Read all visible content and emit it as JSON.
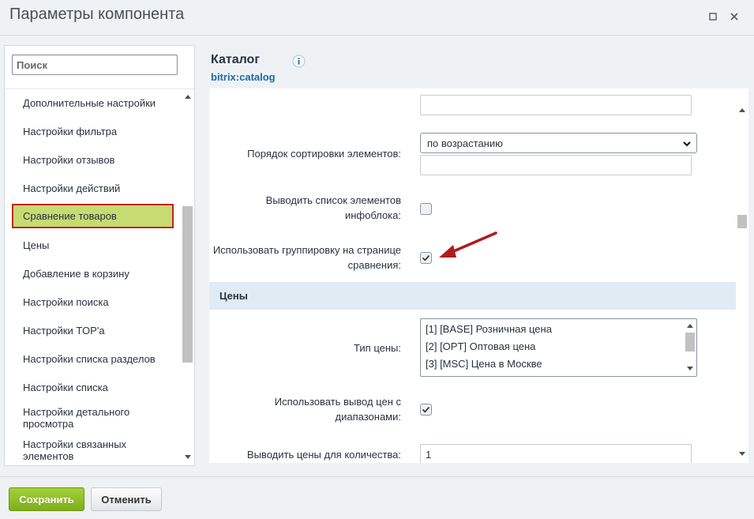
{
  "window": {
    "title": "Параметры компонента"
  },
  "sidebar": {
    "search_placeholder": "Поиск",
    "items": [
      {
        "label": "Дополнительные настройки"
      },
      {
        "label": "Настройки фильтра"
      },
      {
        "label": "Настройки отзывов"
      },
      {
        "label": "Настройки действий"
      },
      {
        "label": "Сравнение товаров",
        "active": true
      },
      {
        "label": "Цены"
      },
      {
        "label": "Добавление в корзину"
      },
      {
        "label": "Настройки поиска"
      },
      {
        "label": "Настройки TOP'а"
      },
      {
        "label": "Настройки списка разделов"
      },
      {
        "label": "Настройки списка"
      },
      {
        "label": "Настройки детального просмотра"
      },
      {
        "label": "Настройки связанных элементов"
      }
    ]
  },
  "component": {
    "name": "Каталог",
    "code": "bitrix:catalog"
  },
  "form": {
    "sort_order_label": "Порядок сортировки элементов:",
    "sort_order_value": "по возрастанию",
    "show_list_label": "Выводить список элементов инфоблока:",
    "show_list_checked": false,
    "use_grouping_label": "Использовать группировку на странице сравнения:",
    "use_grouping_checked": true,
    "prices_section": "Цены",
    "price_type_label": "Тип цены:",
    "price_type_options": [
      "[1] [BASE] Розничная цена",
      "[2] [OPT] Оптовая цена",
      "[3] [MSC] Цена в Москве"
    ],
    "use_ranges_label": "Использовать вывод цен с диапазонами:",
    "use_ranges_checked": true,
    "price_qty_label": "Выводить цены для количества:",
    "price_qty_value": "1"
  },
  "footer": {
    "save": "Сохранить",
    "cancel": "Отменить"
  },
  "colors": {
    "accent_green": "#8fbe26",
    "active_item": "#c6db72",
    "annotation": "#c22323",
    "section_bg": "#e0ebf4"
  }
}
